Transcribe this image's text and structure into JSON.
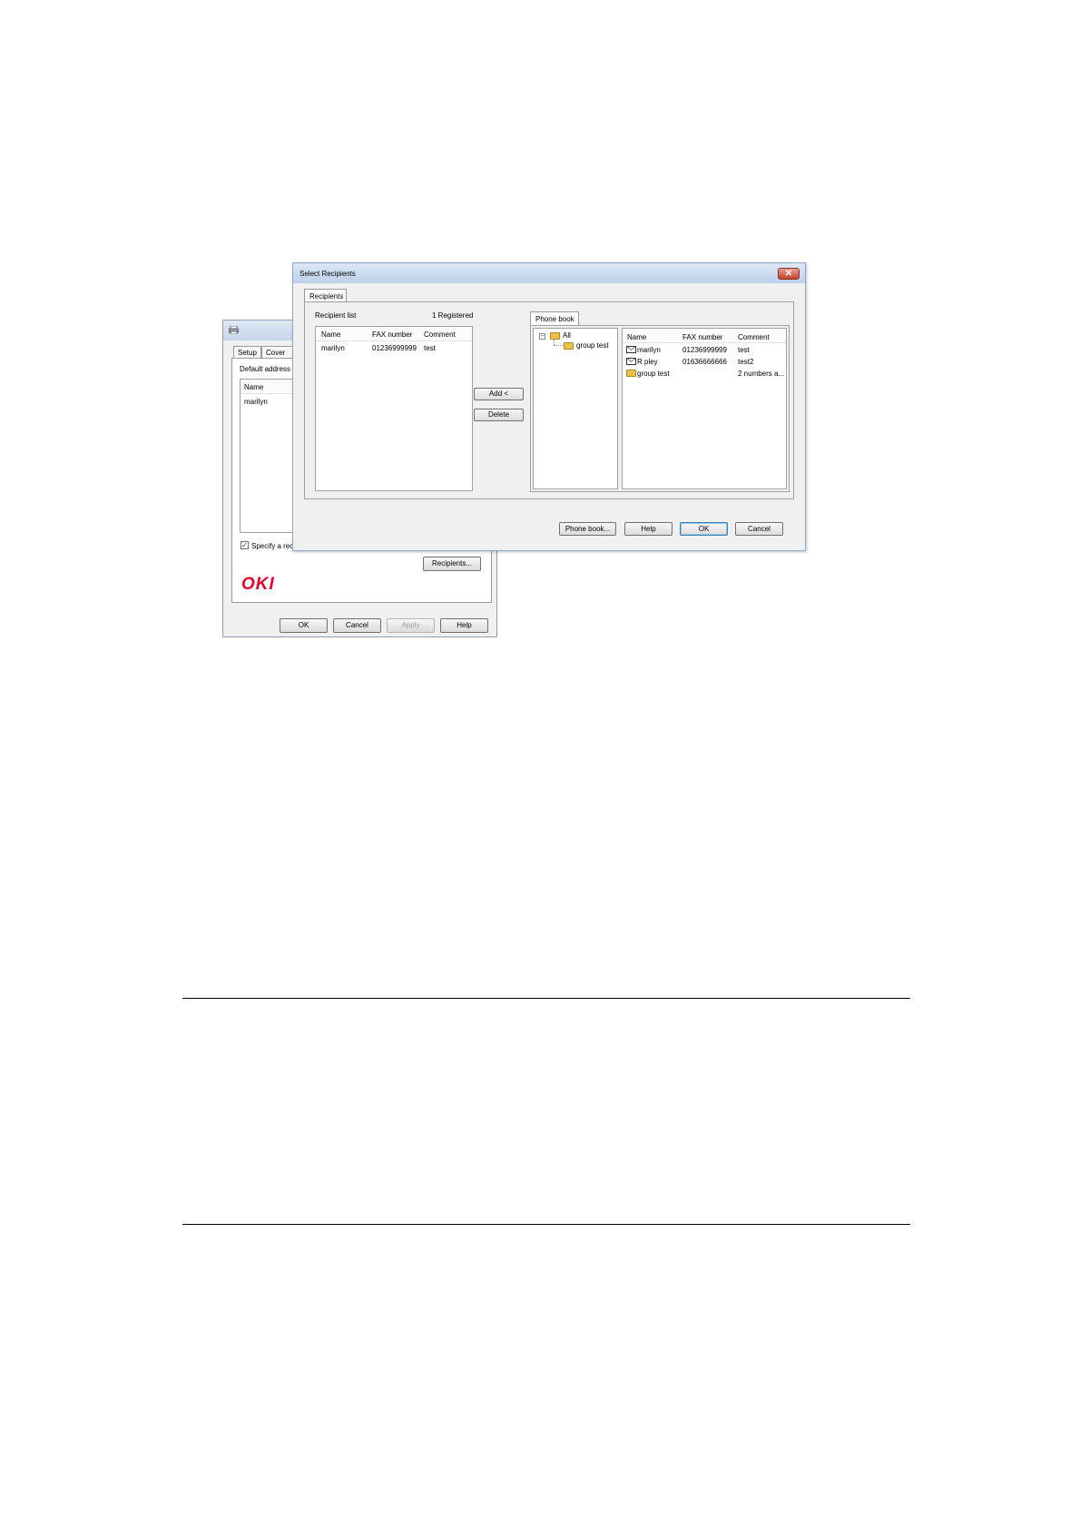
{
  "back_window": {
    "tabs": [
      "Setup",
      "Cover Sh"
    ],
    "default_address_label": "Default address l",
    "list_header_name": "Name",
    "list_item": "marilyn",
    "specify_checkbox_label": "Specify a recipient at print time",
    "specify_checked": true,
    "recipients_button": "Recipients...",
    "logo": "OKI",
    "buttons": {
      "ok": "OK",
      "cancel": "Cancel",
      "apply": "Apply",
      "help": "Help"
    }
  },
  "dialog": {
    "title": "Select Recipients",
    "close_symbol": "✕",
    "tab": "Recipients",
    "recipient_list_label": "Recipient list",
    "registered_count": "1 Registered",
    "recipient_columns": [
      "Name",
      "FAX number",
      "Comment"
    ],
    "recipients": [
      {
        "name": "marilyn",
        "fax": "01236999999",
        "comment": "test"
      }
    ],
    "add_button": "Add <",
    "delete_button": "Delete",
    "phone_book_tab": "Phone book",
    "tree": {
      "expander": "−",
      "root": "All",
      "child": "group test"
    },
    "phonebook_columns": [
      "Name",
      "FAX number",
      "Comment"
    ],
    "phonebook": [
      {
        "icon": "envelope-icon",
        "name": "marilyn",
        "fax": "01236999999",
        "comment": "test"
      },
      {
        "icon": "envelope-icon",
        "name": "R pley",
        "fax": "01636666666",
        "comment": "test2"
      },
      {
        "icon": "folder-icon",
        "name": "group test",
        "fax": "",
        "comment": "2 numbers a..."
      }
    ],
    "buttons": {
      "phone_book": "Phone book...",
      "help": "Help",
      "ok": "OK",
      "cancel": "Cancel"
    }
  }
}
